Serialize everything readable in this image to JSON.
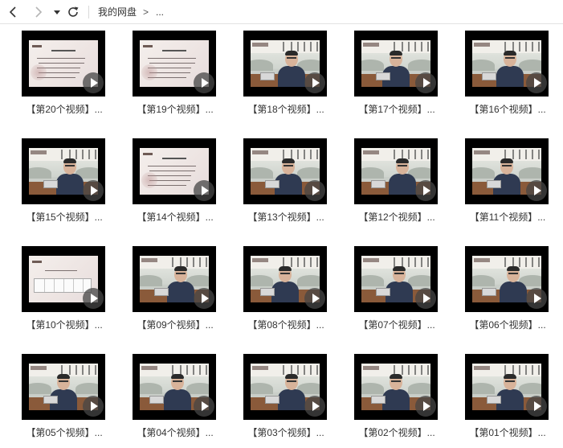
{
  "nav": {
    "breadcrumb": [
      "我的网盘",
      "..."
    ],
    "separator": ">"
  },
  "colors": {
    "thumb_frame": "#000000",
    "play_overlay": "#464646",
    "text": "#333333"
  },
  "items": [
    {
      "label": "【第20个视频】...",
      "thumb": "doc"
    },
    {
      "label": "【第19个视频】...",
      "thumb": "doc"
    },
    {
      "label": "【第18个视频】...",
      "thumb": "video"
    },
    {
      "label": "【第17个视频】...",
      "thumb": "video"
    },
    {
      "label": "【第16个视频】...",
      "thumb": "video"
    },
    {
      "label": "【第15个视频】...",
      "thumb": "video"
    },
    {
      "label": "【第14个视频】...",
      "thumb": "doc"
    },
    {
      "label": "【第13个视频】...",
      "thumb": "video"
    },
    {
      "label": "【第12个视频】...",
      "thumb": "video"
    },
    {
      "label": "【第11个视频】...",
      "thumb": "video"
    },
    {
      "label": "【第10个视频】...",
      "thumb": "table"
    },
    {
      "label": "【第09个视频】...",
      "thumb": "video"
    },
    {
      "label": "【第08个视频】...",
      "thumb": "video"
    },
    {
      "label": "【第07个视频】...",
      "thumb": "video"
    },
    {
      "label": "【第06个视频】...",
      "thumb": "video"
    },
    {
      "label": "【第05个视频】...",
      "thumb": "video"
    },
    {
      "label": "【第04个视频】...",
      "thumb": "video"
    },
    {
      "label": "【第03个视频】...",
      "thumb": "video"
    },
    {
      "label": "【第02个视频】...",
      "thumb": "video"
    },
    {
      "label": "【第01个视频】...",
      "thumb": "video"
    }
  ]
}
